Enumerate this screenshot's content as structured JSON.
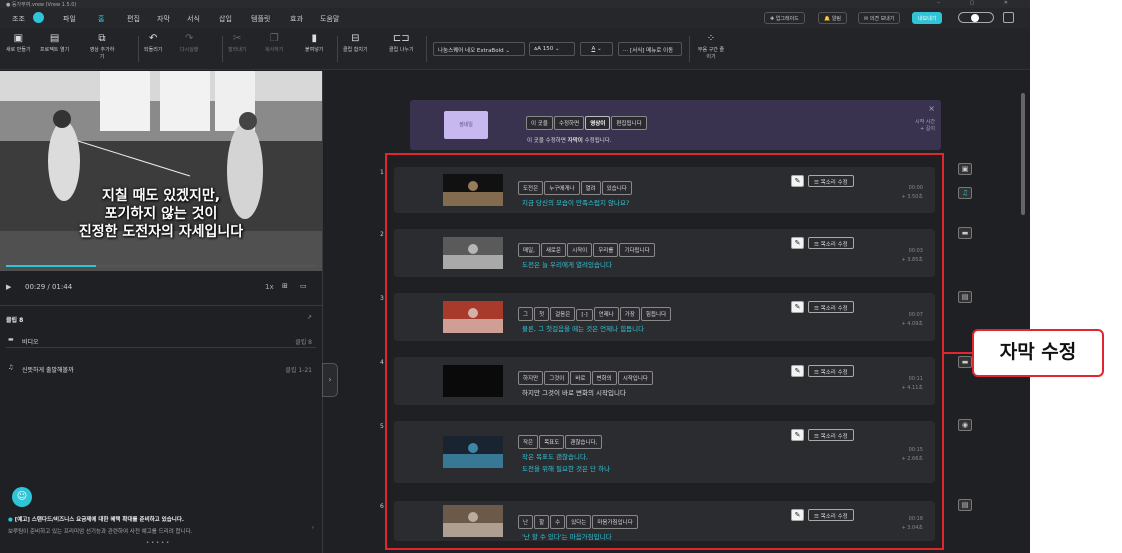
{
  "window": {
    "title": "● 등가부여.vrew (Vrew 1.5.0)",
    "controls": "– ▢ ✕"
  },
  "menu": {
    "items": [
      "조조",
      "파일",
      "홈",
      "편집",
      "자막",
      "서식",
      "삽입",
      "템플릿",
      "효과",
      "도움말"
    ],
    "upgrade": "✚ 업그레이드",
    "alarm": "🔔 알림",
    "feedback": "✉ 의견 보내기",
    "export": "내보내기"
  },
  "toolbar": {
    "new": "새로 만들기",
    "open": "프로젝트 열기",
    "add_video": "영상 추가하기",
    "undo": "되돌리기",
    "redo": "다시실행",
    "cut": "잘라내기",
    "copy": "복사하기",
    "paste": "붙여넣기",
    "merge": "클립 합치기",
    "split": "클립 나누기",
    "font": "나눔스퀘어 네오 ExtraBold",
    "size": "150",
    "font_color": "A",
    "style_move": "··· [서식] 메뉴로 이동",
    "silence": "무음 구간 줄이기",
    "size_prefix": "ᴀA"
  },
  "video": {
    "subtitle_lines": [
      "지칠 때도 있겠지만,",
      "포기하지 않는 것이",
      "진정한 도전자의 자세입니다"
    ],
    "time": "00:29 / 01:44",
    "speed": "1x",
    "progress": 0.29
  },
  "clip_panel": {
    "title": "클립 8",
    "track_video": "비디오",
    "track_video_right": "클립 8",
    "track_music": "신뜻하게 출발해볼까",
    "track_music_right": "클립 1-21"
  },
  "notice": {
    "line1": "[예고] 스탠다드/비즈니스 요금제에 대한 혜택 확대를 준비하고 있습니다.",
    "line2": "보루팀이 준비하고 있는 프리미엄 선기능과 관련하여 사전 예고를 드리려 합니다.",
    "dots": "• • • • •"
  },
  "guide": {
    "thumb_label": "썸네일",
    "chips": [
      "이 곳을",
      "수정하면",
      "영상이",
      "편집됩니다"
    ],
    "desc_pre": "이 곳을 수정하면 ",
    "desc_bold": "자막이",
    "desc_post": " 수정됩니다.",
    "right1": "시작 시간",
    "right2": "+ 길이",
    "close": "×"
  },
  "voice_label": "목소리 수정",
  "callout": "자막 수정",
  "clips": [
    {
      "num": "1",
      "words": [
        "도전은",
        "누구에게나",
        "열려",
        "있습니다"
      ],
      "lines": [
        "지금 당신의 모습이 만족스럽지 않나요?"
      ],
      "time": "00:00",
      "dur": "+ 3.50초"
    },
    {
      "num": "2",
      "words": [
        "매일,",
        "새로운",
        "시작이",
        "우리를",
        "기다립니다"
      ],
      "lines": [
        "도전은 늘 우리에게 열려있습니다"
      ],
      "time": "00:03",
      "dur": "+ 3.85초"
    },
    {
      "num": "3",
      "words": [
        "그",
        "첫",
        "걸음은",
        "[-]",
        "언제나",
        "가장",
        "힘듭니다"
      ],
      "lines": [
        "물론, 그 첫걸음을 떼는 것은 언제나 힘듭니다"
      ],
      "time": "00:07",
      "dur": "+ 4.09초"
    },
    {
      "num": "4",
      "words": [
        "하지만",
        "그것이",
        "바로",
        "변화의",
        "시작입니다"
      ],
      "lines": [
        "하지만 그것이 바로 변화의 시작입니다"
      ],
      "time": "00:11",
      "dur": "+ 4.11초"
    },
    {
      "num": "5",
      "words": [
        "작은",
        "목표도",
        "괜찮습니다,"
      ],
      "lines": [
        "작은 목표도 괜찮습니다,",
        "도전을 위해 필요한 것은 단 하나"
      ],
      "time": "00:15",
      "dur": "+ 2.66초"
    },
    {
      "num": "6",
      "words": [
        "난",
        "할",
        "수",
        "있다는",
        "마음가짐입니다"
      ],
      "lines": [
        "'난 할 수 있다'는 마음가짐입니다"
      ],
      "time": "00:18",
      "dur": "+ 3.04초"
    }
  ],
  "colors": {
    "accent": "#2fc4d6",
    "callout": "#e0262f",
    "guide_bg": "#3a3350"
  }
}
